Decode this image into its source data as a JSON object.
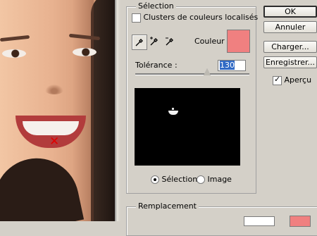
{
  "selection": {
    "title": "Sélection",
    "clusters_label": "Clusters de couleurs localisés",
    "clusters_checked": false,
    "color_label": "Couleur :",
    "color_value": "#f08080",
    "tolerance_label": "Tolérance :",
    "tolerance_value": "130",
    "tolerance_fraction": 0.65,
    "radio_selection": "Sélection",
    "radio_image": "Image",
    "selected_radio": "Sélection"
  },
  "tools": [
    "eyedropper-icon",
    "eyedropper-plus-icon",
    "eyedropper-minus-icon"
  ],
  "buttons": {
    "ok": "OK",
    "cancel": "Annuler",
    "load": "Charger...",
    "save": "Enregistrer..."
  },
  "preview_option": {
    "label": "Aperçu",
    "checked": true
  },
  "replacement": {
    "title": "Remplacement"
  }
}
